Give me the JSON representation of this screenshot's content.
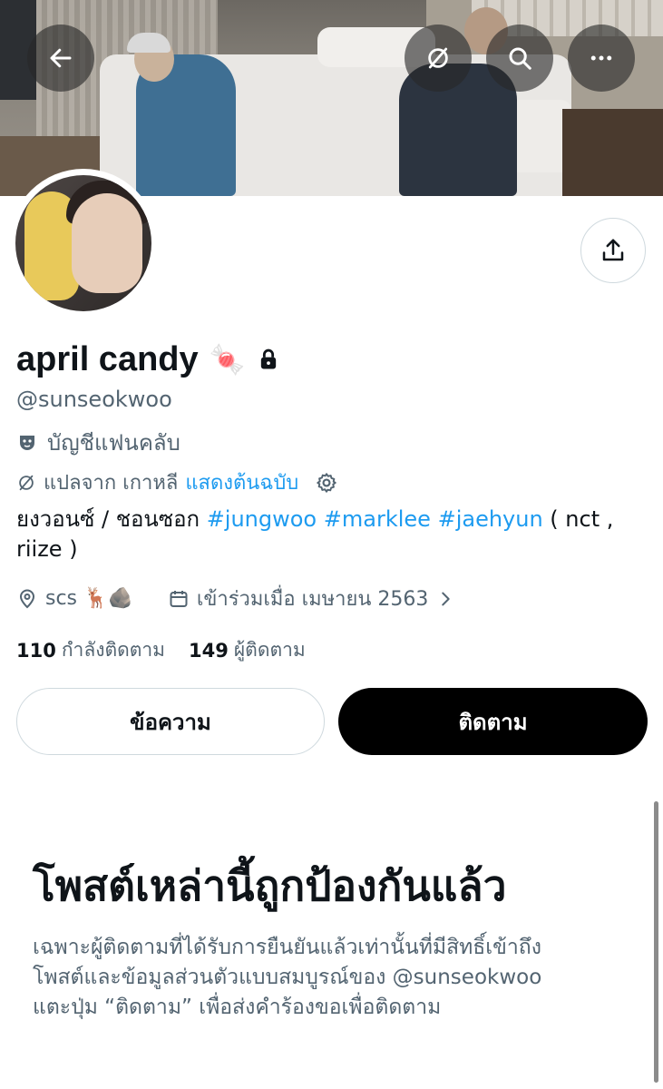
{
  "header": {
    "back_icon": "arrow-left-icon",
    "translate_icon": "translate-icon",
    "search_icon": "search-icon",
    "more_icon": "more-horizontal-icon"
  },
  "profile": {
    "display_name": "april candy",
    "name_emoji": "🍬",
    "lock_icon": "lock-icon",
    "handle": "@sunseokwoo",
    "fan_account_label": "บัญชีแฟนคลับ",
    "translated_from": "แปลจาก เกาหลี",
    "show_original": "แสดงต้นฉบับ",
    "bio": {
      "prefix": "ยงวอนซ์ / ชอนซอก ",
      "tags": [
        "#jungwoo",
        "#marklee",
        "#jaehyun"
      ],
      "suffix_line1": " ( nct ,",
      "suffix_line2": "riize )"
    },
    "location": "scs 🦌🪨",
    "joined": "เข้าร่วมเมื่อ เมษายน 2563",
    "following_count": "110",
    "following_label": "กำลังติดตาม",
    "followers_count": "149",
    "followers_label": "ผู้ติดตาม"
  },
  "actions": {
    "message_label": "ข้อความ",
    "follow_label": "ติดตาม"
  },
  "protected": {
    "title": "โพสต์เหล่านี้ถูกป้องกันแล้ว",
    "line1": "เฉพาะผู้ติดตามที่ได้รับการยืนยันแล้วเท่านั้นที่มีสิทธิ์เข้าถึง",
    "line2": "โพสต์และข้อมูลส่วนตัวแบบสมบูรณ์ของ @sunseokwoo",
    "line3": "แตะปุ่ม “ติดตาม” เพื่อส่งคำร้องขอเพื่อติดตาม"
  },
  "colors": {
    "accent": "#1d9bf0",
    "text": "#0f1419",
    "secondary": "#536471",
    "border": "#cfd9de"
  }
}
